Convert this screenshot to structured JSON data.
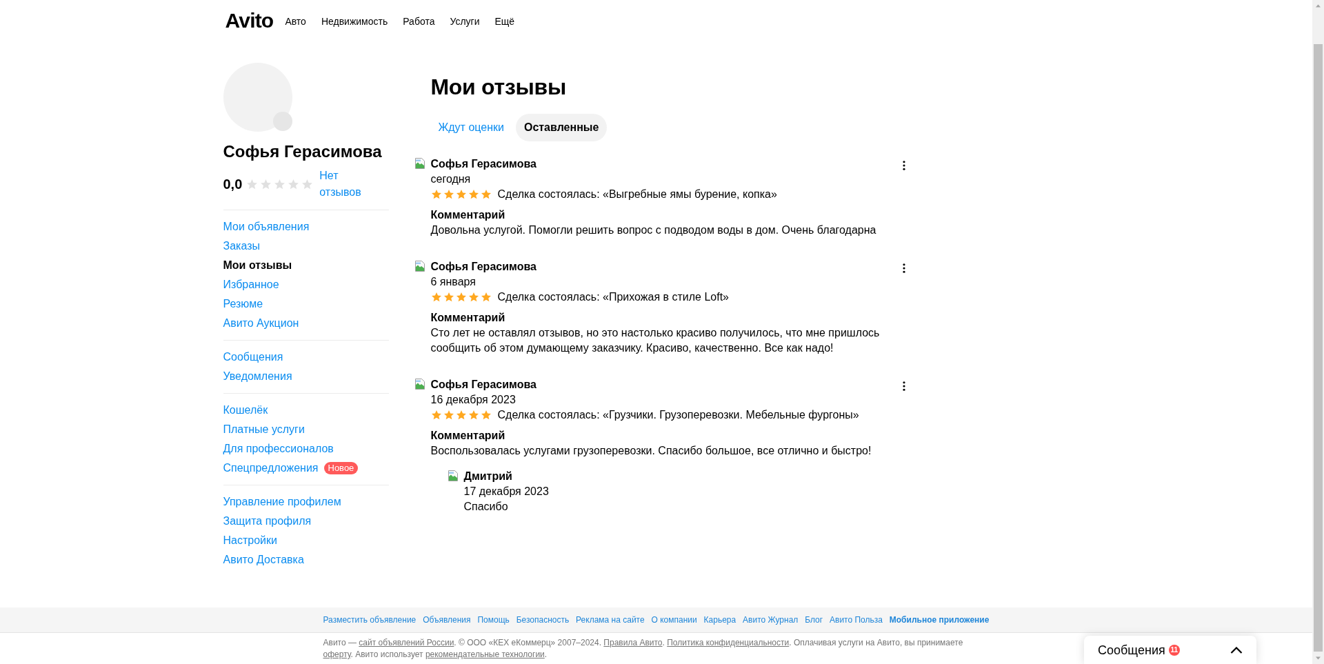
{
  "header": {
    "logo": "Avito",
    "nav": [
      "Авто",
      "Недвижимость",
      "Работа",
      "Услуги",
      "Ещё"
    ]
  },
  "profile": {
    "name": "Софья Герасимова",
    "rating": "0,0",
    "stars": 0,
    "reviews_link": "Нет отзывов"
  },
  "sidebar": {
    "groups": [
      {
        "items": [
          {
            "label": "Мои объявления",
            "selected": false
          },
          {
            "label": "Заказы",
            "selected": false
          },
          {
            "label": "Мои отзывы",
            "selected": true
          },
          {
            "label": "Избранное",
            "selected": false
          },
          {
            "label": "Резюме",
            "selected": false
          },
          {
            "label": "Авито Аукцион",
            "selected": false
          }
        ]
      },
      {
        "items": [
          {
            "label": "Сообщения",
            "selected": false
          },
          {
            "label": "Уведомления",
            "selected": false
          }
        ]
      },
      {
        "items": [
          {
            "label": "Кошелёк",
            "selected": false
          },
          {
            "label": "Платные услуги",
            "selected": false
          },
          {
            "label": "Для профессионалов",
            "selected": false
          },
          {
            "label": "Спецпредложения",
            "selected": false,
            "badge": "Новое"
          }
        ]
      },
      {
        "items": [
          {
            "label": "Управление профилем",
            "selected": false
          },
          {
            "label": "Защита профиля",
            "selected": false
          },
          {
            "label": "Настройки",
            "selected": false
          },
          {
            "label": "Авито Доставка",
            "selected": false
          }
        ]
      }
    ]
  },
  "page_title": "Мои отзывы",
  "tabs": [
    {
      "label": "Ждут оценки",
      "selected": false
    },
    {
      "label": "Оставленные",
      "selected": true
    }
  ],
  "reviews": [
    {
      "author": "Софья Герасимова",
      "date": "сегодня",
      "stars": 5,
      "deal": "Сделка состоялась: «Выгребные ямы бурение, копка»",
      "comment_label": "Комментарий",
      "comment": "Довольна услугой. Помогли решить вопрос с подводом воды в дом. Очень благодарна"
    },
    {
      "author": "Софья Герасимова",
      "date": "6 января",
      "stars": 5,
      "deal": "Сделка состоялась: «Прихожая в стиле Loft»",
      "comment_label": "Комментарий",
      "comment": "Сто лет не оставлял отзывов, но это настолько красиво получилось, что мне пришлось сообщить об этом думающему заказчику. Красиво, качественно. Все как надо!"
    },
    {
      "author": "Софья Герасимова",
      "date": "16 декабря 2023",
      "stars": 5,
      "deal": "Сделка состоялась: «Грузчики. Грузоперевозки. Мебельные фургоны»",
      "comment_label": "Комментарий",
      "comment": "Воспользовалась услугами грузоперевозки. Спасибо большое, все отлично и быстро!",
      "reply": {
        "author": "Дмитрий",
        "date": "17 декабря 2023",
        "text": "Спасибо"
      }
    }
  ],
  "footer": {
    "links": [
      {
        "label": "Разместить объявление",
        "emphasized": false
      },
      {
        "label": "Объявления",
        "emphasized": false
      },
      {
        "label": "Помощь",
        "emphasized": false
      },
      {
        "label": "Безопасность",
        "emphasized": false
      },
      {
        "label": "Реклама на сайте",
        "emphasized": false
      },
      {
        "label": "О компании",
        "emphasized": false
      },
      {
        "label": "Карьера",
        "emphasized": false
      },
      {
        "label": "Авито Журнал",
        "emphasized": false
      },
      {
        "label": "Блог",
        "emphasized": false
      },
      {
        "label": "Авито Польза",
        "emphasized": false
      },
      {
        "label": "Мобильное приложение",
        "emphasized": true
      }
    ],
    "legal": [
      {
        "kind": "text",
        "text": "Авито — "
      },
      {
        "kind": "link",
        "text": "сайт объявлений России"
      },
      {
        "kind": "text",
        "text": ". © ООО «КЕХ еКоммерц» 2007–2024. "
      },
      {
        "kind": "link",
        "text": "Правила Авито"
      },
      {
        "kind": "text",
        "text": ". "
      },
      {
        "kind": "link",
        "text": "Политика конфиденциальности"
      },
      {
        "kind": "text",
        "text": ". Оплачивая услуги на Авито, вы принимаете "
      },
      {
        "kind": "link",
        "text": "оферту"
      },
      {
        "kind": "text",
        "text": ". Авито использует "
      },
      {
        "kind": "link",
        "text": "рекомендательные технологии"
      },
      {
        "kind": "text",
        "text": "."
      }
    ]
  },
  "messages_widget": {
    "label": "Сообщения",
    "count": "11"
  }
}
